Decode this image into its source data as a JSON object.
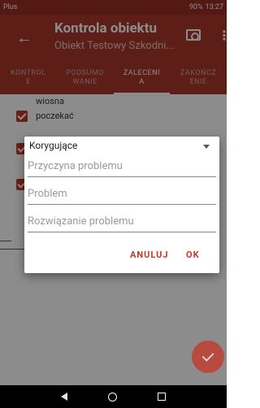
{
  "status_bar": {
    "carrier": "Plus",
    "battery": "90%",
    "time": "13:27"
  },
  "toolbar": {
    "title": "Kontrola obiektu",
    "subtitle": "Obiekt Testowy Szkodni..."
  },
  "tabs": [
    {
      "label": "KONTROLE",
      "line1": "KONTROL",
      "line2": "E",
      "active": false
    },
    {
      "label": "PODSUMOWANIE",
      "line1": "PODSUMO",
      "line2": "WANIE",
      "active": false
    },
    {
      "label": "ZALECENIA",
      "line1": "ZALECENI",
      "line2": "A",
      "active": true
    },
    {
      "label": "ZAKOŃCZENIE",
      "line1": "ZAKOŃCZ",
      "line2": "ENIE",
      "active": false
    }
  ],
  "list": {
    "item1_line1": "wiosna",
    "item1_line2": "poczekać"
  },
  "dialog": {
    "select_value": "Korygujące",
    "field1_placeholder": "Przyczyna problemu",
    "field2_placeholder": "Problem",
    "field3_placeholder": "Rozwiązanie problemu",
    "cancel_label": "ANULUJ",
    "ok_label": "OK"
  },
  "colors": {
    "primary": "#a9372d",
    "accent": "#c0392b"
  }
}
